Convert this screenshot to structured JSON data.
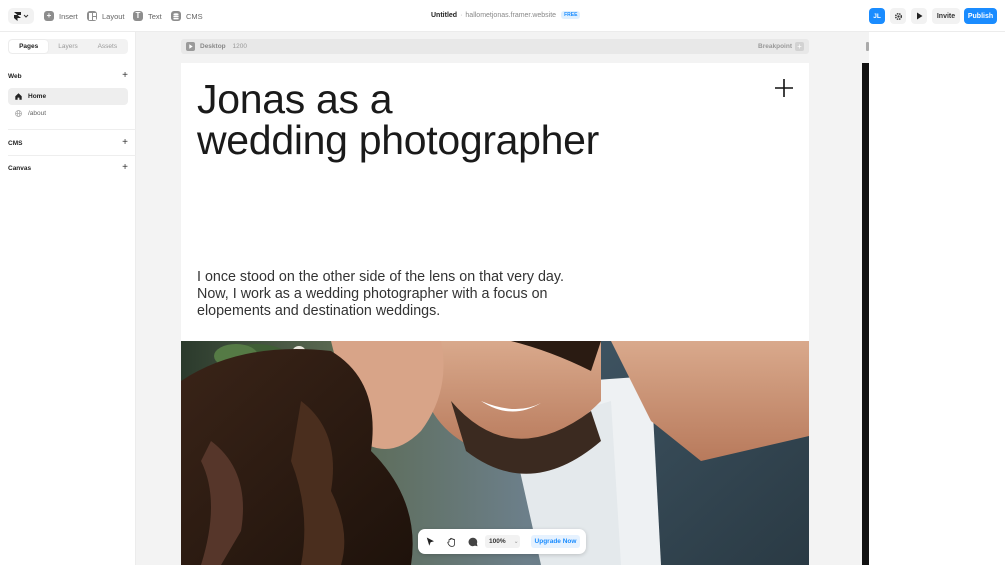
{
  "topbar": {
    "tools": [
      {
        "label": "Insert",
        "icon": "plus-icon"
      },
      {
        "label": "Layout",
        "icon": "layout-icon"
      },
      {
        "label": "Text",
        "icon": "text-icon"
      },
      {
        "label": "CMS",
        "icon": "database-icon"
      }
    ],
    "project_title": "Untitled",
    "separator": "·",
    "site_domain": "hallometjonas.framer.website",
    "plan_badge": "FREE",
    "avatar_initials": "JL",
    "invite_label": "Invite",
    "publish_label": "Publish"
  },
  "sidebar": {
    "tabs": [
      "Pages",
      "Layers",
      "Assets"
    ],
    "active_tab": "Pages",
    "sections": {
      "web": "Web",
      "cms": "CMS",
      "canvas": "Canvas"
    },
    "pages": [
      {
        "label": "Home",
        "icon": "home-icon",
        "active": true
      },
      {
        "label": "/about",
        "icon": "globe-icon",
        "active": false
      }
    ]
  },
  "frame": {
    "name": "Desktop",
    "width": "1200",
    "breakpoint_label": "Breakpoint"
  },
  "site": {
    "headline_line1": "Jonas as a",
    "headline_line2": "wedding photographer",
    "intro": "I once stood on the other side of the lens on that very day. Now, I work as a wedding photographer with a focus on elopements and destination weddings."
  },
  "bottom_toolbar": {
    "zoom": "100%",
    "upgrade_label": "Upgrade Now"
  },
  "colors": {
    "accent": "#1a8cff",
    "canvas_bg": "#f3f3f3"
  }
}
